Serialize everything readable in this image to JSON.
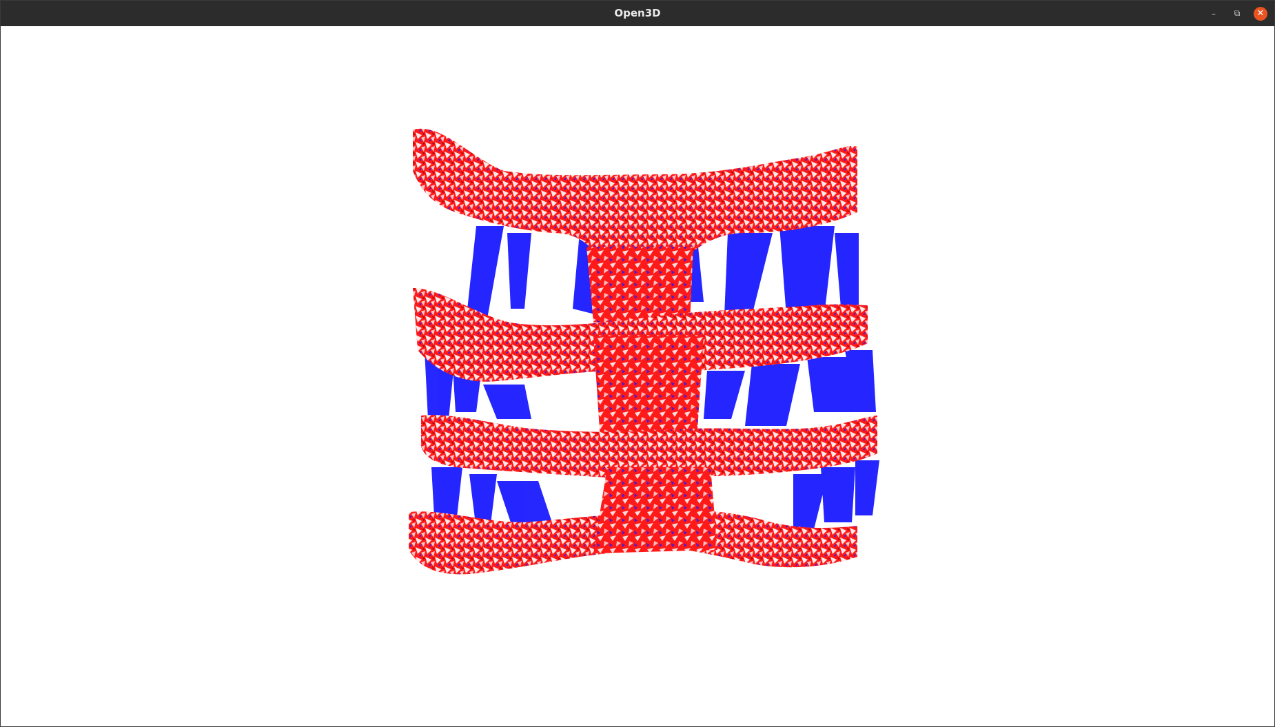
{
  "window": {
    "title": "Open3D",
    "controls": {
      "minimize_icon": "minimize-icon",
      "maximize_icon": "restore-icon",
      "close_icon": "close-icon"
    }
  },
  "viewport": {
    "background": "#ffffff",
    "mesh": {
      "face_color": "#ff1a1a",
      "backface_color": "#1a1aff",
      "edge_highlight": "#ffffff"
    }
  },
  "colors": {
    "titlebar": "#2c2c2c",
    "title_text": "#e8e8e8",
    "close_button": "#e95420"
  }
}
